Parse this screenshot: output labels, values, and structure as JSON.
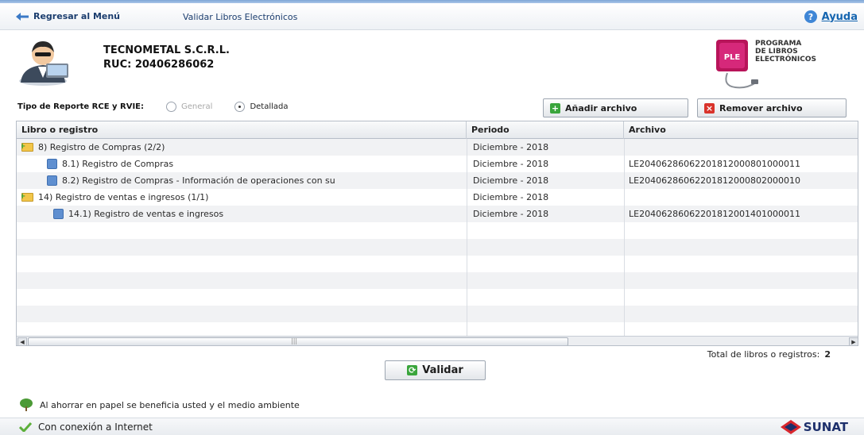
{
  "nav": {
    "back_label": "Regresar al Menú",
    "current_label": "Validar Libros Electrónicos",
    "help_label": "Ayuda"
  },
  "company": {
    "name": "TECNOMETAL S.C.R.L.",
    "ruc": "RUC: 20406286062"
  },
  "logo": {
    "badge": "PLE",
    "line1": "PROGRAMA",
    "line2": "DE LIBROS",
    "line3": "ELECTRÓNICOS"
  },
  "report": {
    "label": "Tipo de Reporte RCE y RVIE:",
    "option_general": "General",
    "option_detallada": "Detallada",
    "selected": "Detallada"
  },
  "buttons": {
    "add": "Añadir archivo",
    "remove": "Remover archivo",
    "validate": "Validar"
  },
  "grid": {
    "headers": {
      "libro": "Libro o registro",
      "periodo": "Periodo",
      "archivo": "Archivo"
    },
    "rows": [
      {
        "libro": "8) Registro de Compras (2/2)",
        "periodo": "Diciembre - 2018",
        "archivo": ""
      },
      {
        "libro": "8.1) Registro de Compras",
        "periodo": "Diciembre - 2018",
        "archivo": "LE20406286062201812000801000011"
      },
      {
        "libro": "8.2) Registro de Compras - Información de operaciones con su",
        "periodo": "Diciembre - 2018",
        "archivo": "LE20406286062201812000802000010"
      },
      {
        "libro": "14) Registro de ventas e ingresos (1/1)",
        "periodo": "Diciembre - 2018",
        "archivo": ""
      },
      {
        "libro": "14.1) Registro de ventas e ingresos",
        "periodo": "Diciembre - 2018",
        "archivo": "LE20406286062201812001401000011"
      }
    ]
  },
  "total": {
    "label": "Total de libros o registros:",
    "value": "2"
  },
  "eco_message": "Al ahorrar en papel se beneficia usted y el medio ambiente",
  "status": "Con conexión a Internet",
  "brand": "SUNAT",
  "colors": {
    "accent": "#1b3d6e",
    "link": "#1565b0",
    "add": "#3aa53c",
    "remove": "#d9332b"
  }
}
